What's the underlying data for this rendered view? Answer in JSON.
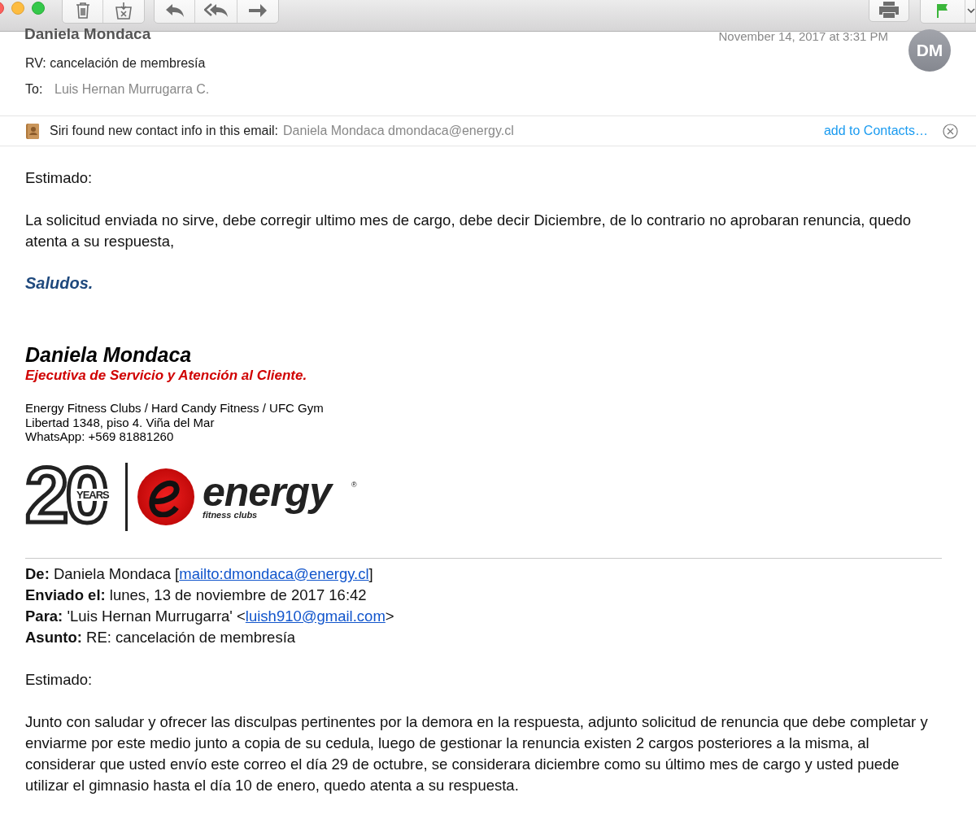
{
  "header": {
    "sender": "Daniela Mondaca",
    "date": "November 14, 2017 at 3:31 PM",
    "subject": "RV: cancelación de membresía",
    "to_label": "To:",
    "to": "Luis Hernan Murrugarra C.",
    "avatar": "DM"
  },
  "siri_banner": {
    "text": "Siri found new contact info in this email:",
    "contact": "Daniela Mondaca dmondaca@energy.cl",
    "action": "add to Contacts…"
  },
  "message": {
    "greeting": "Estimado:",
    "paragraph": "La solicitud enviada no sirve, debe corregir ultimo mes de cargo, debe decir Diciembre, de lo contrario no aprobaran renuncia, quedo atenta a su respuesta,",
    "closing": "Saludos."
  },
  "signature": {
    "name": "Daniela Mondaca",
    "title": "Ejecutiva de Servicio y Atención al Cliente.",
    "lines": [
      "Energy Fitness Clubs / Hard Candy Fitness / UFC Gym",
      "Libertad 1348,  piso 4. Viña del Mar",
      "WhatsApp: +569 81881260"
    ],
    "logo": {
      "years_number": "20",
      "years_word": "YEARS",
      "brand": "energy",
      "registered": "®",
      "tagline": "fitness clubs"
    }
  },
  "quoted_header": [
    {
      "label": "De:",
      "parts": [
        {
          "kind": "text",
          "text": "Daniela Mondaca ["
        },
        {
          "kind": "link",
          "text": "mailto:dmondaca@energy.cl"
        },
        {
          "kind": "text",
          "text": "]"
        }
      ]
    },
    {
      "label": "Enviado el:",
      "parts": [
        {
          "kind": "text",
          "text": "lunes, 13 de noviembre de 2017 16:42"
        }
      ]
    },
    {
      "label": "Para:",
      "parts": [
        {
          "kind": "text",
          "text": "'Luis Hernan Murrugarra' <"
        },
        {
          "kind": "link",
          "text": "luish910@gmail.com"
        },
        {
          "kind": "text",
          "text": ">"
        }
      ]
    },
    {
      "label": "Asunto:",
      "parts": [
        {
          "kind": "text",
          "text": "RE: cancelación de membresía"
        }
      ]
    }
  ],
  "quoted_message": {
    "greeting": "Estimado:",
    "paragraph": "Junto con saludar y ofrecer las disculpas pertinentes por la demora en la respuesta, adjunto solicitud de renuncia que debe completar y enviarme por este medio junto a copia de su cedula, luego de gestionar la renuncia existen 2 cargos posteriores a la misma, al considerar que usted envío este correo el día 29 de octubre, se considerara diciembre como su último mes de cargo y usted puede utilizar el gimnasio hasta el día 10 de enero, quedo atenta a su respuesta."
  }
}
